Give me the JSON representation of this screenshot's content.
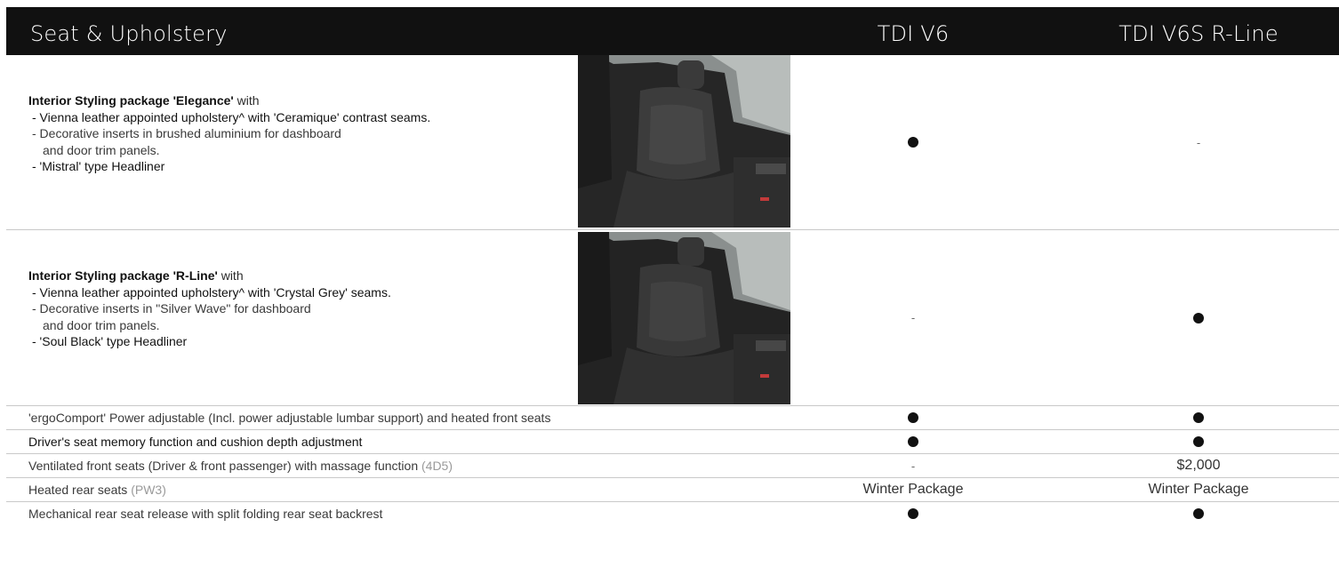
{
  "header": {
    "title": "Seat & Upholstery",
    "col1": "TDI V6",
    "col2": "TDI V6S R-Line"
  },
  "packages": [
    {
      "title": "Interior Styling package 'Elegance'",
      "with": " with",
      "lines": [
        "- Vienna leather appointed upholstery^ with 'Ceramique' contrast seams.",
        "- Decorative inserts in brushed aluminium for dashboard",
        "and door trim panels.",
        "- 'Mistral' type Headliner"
      ],
      "image_alt": "Front seats interior with Elegance upholstery",
      "col1": "dot",
      "col2": "-"
    },
    {
      "title": "Interior Styling package 'R-Line'",
      "with": " with",
      "lines": [
        "- Vienna leather appointed upholstery^ with 'Crystal Grey' seams.",
        "- Decorative inserts in \"Silver Wave\" for dashboard",
        "and door trim panels.",
        "- 'Soul Black' type Headliner"
      ],
      "image_alt": "Front seats interior with R-Line upholstery",
      "col1": "-",
      "col2": "dot"
    }
  ],
  "rows": [
    {
      "label": "'ergoComport' Power adjustable (Incl. power adjustable lumbar support) and heated front seats",
      "code": "",
      "col1": "dot",
      "col2": "dot"
    },
    {
      "label": "Driver's seat memory function and cushion depth adjustment",
      "code": "",
      "col1": "dot",
      "col2": "dot"
    },
    {
      "label": "Ventilated front seats (Driver & front passenger) with massage function",
      "code": "(4D5)",
      "col1": "-",
      "col2": "$2,000"
    },
    {
      "label": "Heated rear seats",
      "code": "(PW3)",
      "col1": "Winter Package",
      "col2": "Winter Package"
    },
    {
      "label": "Mechanical rear seat release with split folding rear seat backrest",
      "code": "",
      "col1": "dot",
      "col2": "dot"
    }
  ],
  "symbols": {
    "dash": "-"
  },
  "colors": {
    "header_bg": "#111111",
    "header_text": "#ffffff",
    "divider": "#c9c9c9",
    "code_text": "#9a9a9a"
  }
}
